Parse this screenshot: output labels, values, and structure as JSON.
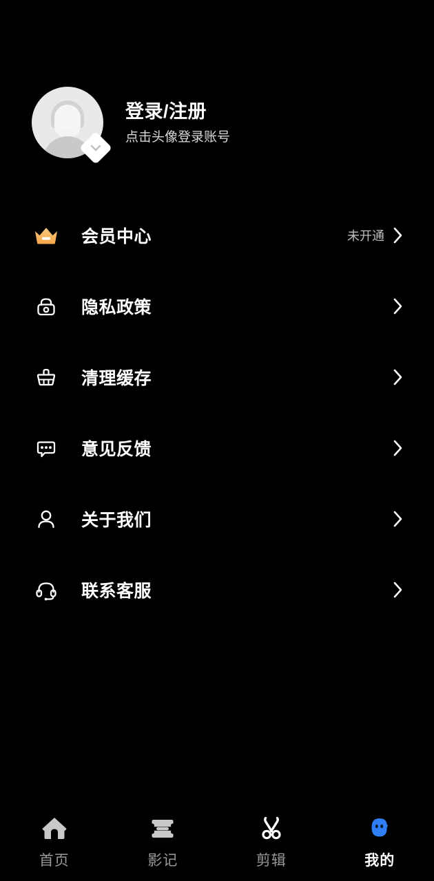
{
  "theme": {
    "background": "#000000",
    "text_primary": "#FFFFFF",
    "text_secondary": "#D9D9D9",
    "text_muted": "#9A9A9A",
    "accent_crown": "#F7B968",
    "accent_active_tab": "#2E7EF5",
    "avatar_bg": "#E9E9E9"
  },
  "profile": {
    "title": "登录/注册",
    "subtitle": "点击头像登录账号",
    "avatar_icon": "default-user-avatar",
    "badge_icon": "chevron-down-badge-icon"
  },
  "menu": {
    "items": [
      {
        "id": "member-center",
        "label": "会员中心",
        "icon": "crown-icon",
        "value": "未开通",
        "chevron": "chevron-right-icon"
      },
      {
        "id": "privacy-policy",
        "label": "隐私政策",
        "icon": "lock-icon",
        "value": "",
        "chevron": "chevron-right-icon"
      },
      {
        "id": "clear-cache",
        "label": "清理缓存",
        "icon": "broom-icon",
        "value": "",
        "chevron": "chevron-right-icon"
      },
      {
        "id": "feedback",
        "label": "意见反馈",
        "icon": "comment-icon",
        "value": "",
        "chevron": "chevron-right-icon"
      },
      {
        "id": "about-us",
        "label": "关于我们",
        "icon": "user-icon",
        "value": "",
        "chevron": "chevron-right-icon"
      },
      {
        "id": "contact-support",
        "label": "联系客服",
        "icon": "headset-icon",
        "value": "",
        "chevron": "chevron-right-icon"
      }
    ]
  },
  "tabbar": {
    "active_index": 3,
    "tabs": [
      {
        "id": "home",
        "label": "首页",
        "icon": "home-icon"
      },
      {
        "id": "gallery",
        "label": "影记",
        "icon": "ticket-icon"
      },
      {
        "id": "edit",
        "label": "剪辑",
        "icon": "scissors-icon"
      },
      {
        "id": "mine",
        "label": "我的",
        "icon": "profile-blob-icon"
      }
    ]
  }
}
